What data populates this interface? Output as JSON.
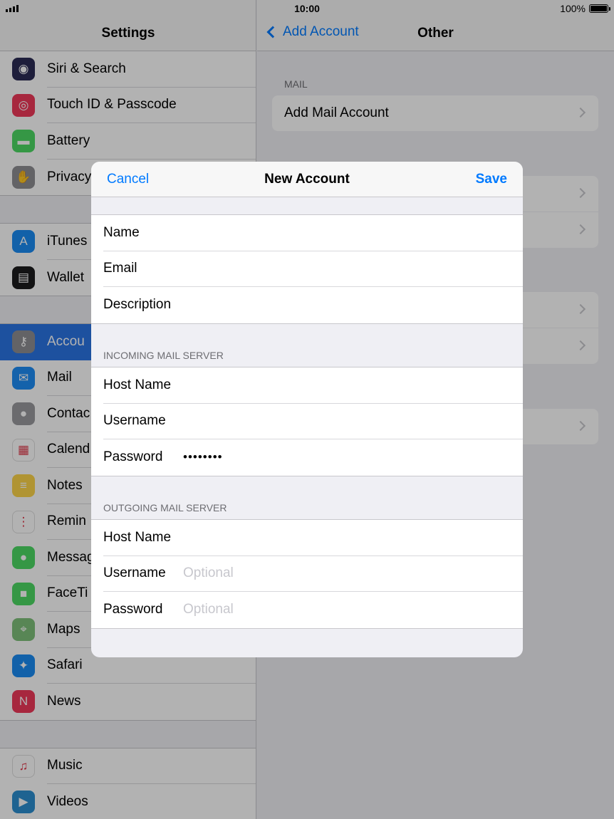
{
  "status": {
    "time": "10:00",
    "battery": "100%"
  },
  "sidebar": {
    "title": "Settings",
    "groups": [
      [
        {
          "label": "Siri & Search",
          "icon": "siri-icon",
          "color": "#2b2b55"
        },
        {
          "label": "Touch ID & Passcode",
          "icon": "fingerprint-icon",
          "color": "#f0385a"
        },
        {
          "label": "Battery",
          "icon": "battery-icon",
          "color": "#4cd964"
        },
        {
          "label": "Privacy",
          "icon": "hand-icon",
          "color": "#8e8e93"
        }
      ],
      [
        {
          "label": "iTunes",
          "icon": "app-store-icon",
          "color": "#1a8cf3"
        },
        {
          "label": "Wallet",
          "icon": "wallet-icon",
          "color": "#1c1c1e"
        }
      ],
      [
        {
          "label": "Accou",
          "icon": "key-icon",
          "color": "#8e8e93",
          "selected": true
        },
        {
          "label": "Mail",
          "icon": "mail-icon",
          "color": "#1e8df5"
        },
        {
          "label": "Contac",
          "icon": "contacts-icon",
          "color": "#9a9a9e"
        },
        {
          "label": "Calend",
          "icon": "calendar-icon",
          "color": "#ffffff"
        },
        {
          "label": "Notes",
          "icon": "notes-icon",
          "color": "#fdd54a"
        },
        {
          "label": "Remin",
          "icon": "reminders-icon",
          "color": "#ffffff"
        },
        {
          "label": "Messag",
          "icon": "messages-icon",
          "color": "#4cd964"
        },
        {
          "label": "FaceTi",
          "icon": "facetime-icon",
          "color": "#4cd964"
        },
        {
          "label": "Maps",
          "icon": "maps-icon",
          "color": "#7fc07a"
        },
        {
          "label": "Safari",
          "icon": "safari-icon",
          "color": "#1a8cf3"
        },
        {
          "label": "News",
          "icon": "news-icon",
          "color": "#f0385a"
        }
      ],
      [
        {
          "label": "Music",
          "icon": "music-icon",
          "color": "#ffffff"
        },
        {
          "label": "Videos",
          "icon": "videos-icon",
          "color": "#2b8fd0"
        }
      ]
    ]
  },
  "detail": {
    "back_label": "Add Account",
    "title": "Other",
    "mail_section": "MAIL",
    "add_mail_label": "Add Mail Account"
  },
  "modal": {
    "cancel": "Cancel",
    "title": "New Account",
    "save": "Save",
    "account_fields": [
      {
        "label": "Name",
        "value": ""
      },
      {
        "label": "Email",
        "value": ""
      },
      {
        "label": "Description",
        "value": ""
      }
    ],
    "incoming_header": "INCOMING MAIL SERVER",
    "incoming_fields": [
      {
        "label": "Host Name",
        "value": ""
      },
      {
        "label": "Username",
        "value": ""
      },
      {
        "label": "Password",
        "value": "••••••••"
      }
    ],
    "outgoing_header": "OUTGOING MAIL SERVER",
    "outgoing_fields": [
      {
        "label": "Host Name",
        "value": "",
        "placeholder": ""
      },
      {
        "label": "Username",
        "value": "",
        "placeholder": "Optional"
      },
      {
        "label": "Password",
        "value": "",
        "placeholder": "Optional"
      }
    ]
  }
}
